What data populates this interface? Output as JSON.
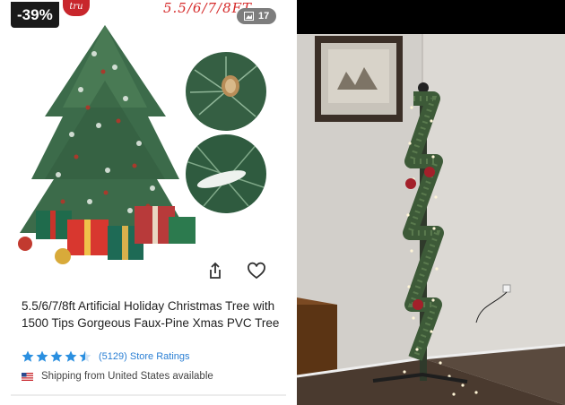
{
  "product": {
    "discount": "-39%",
    "brand_badge": "tru",
    "size_label": "5.5/6/7/8FT",
    "photo_count": "17",
    "title": "5.5/6/7/8ft Artificial Holiday Christmas Tree with 1500 Tips Gorgeous Faux-Pine Xmas PVC Tree",
    "rating": 4.5,
    "ratings_text": "(5129) Store Ratings",
    "shipping_text": "Shipping from United States available"
  },
  "icons": {
    "share": "share-icon",
    "favorite": "heart-icon",
    "gallery": "image-icon",
    "flag": "us-flag-icon",
    "star": "star-icon"
  },
  "colors": {
    "discount_bg": "#1a1a1a",
    "star": "#2a8fe0",
    "link": "#2a7fd4",
    "brand_red": "#c8262c"
  }
}
